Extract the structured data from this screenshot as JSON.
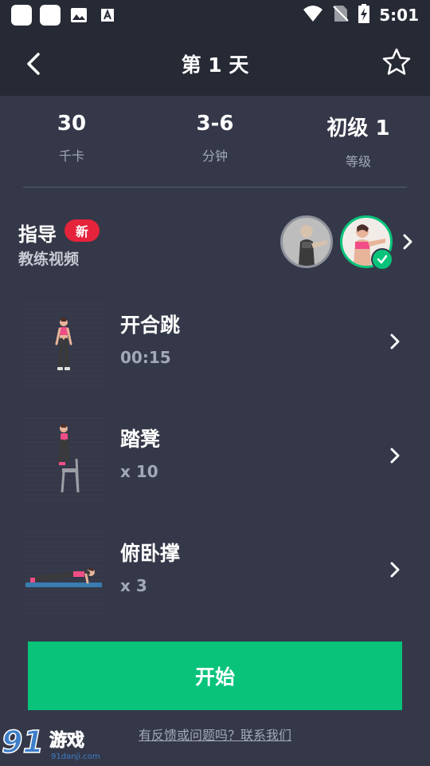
{
  "status_bar": {
    "time": "5:01",
    "icons": [
      "app-icon",
      "app-icon",
      "image-icon",
      "font-icon",
      "wifi-icon",
      "no-sim-icon",
      "battery-charging-icon"
    ]
  },
  "header": {
    "title": "第 1 天",
    "back_icon": "chevron-left-icon",
    "favorite_icon": "star-outline-icon"
  },
  "stats": [
    {
      "value": "30",
      "label": "千卡"
    },
    {
      "value": "3-6",
      "label": "分钟"
    },
    {
      "value": "初级 1",
      "label": "等级"
    }
  ],
  "guide": {
    "title": "指导",
    "badge": "新",
    "subtitle": "教练视频"
  },
  "exercises": [
    {
      "name": "开合跳",
      "detail": "00:15"
    },
    {
      "name": "踏凳",
      "detail": "x 10"
    },
    {
      "name": "俯卧撑",
      "detail": "x 3"
    }
  ],
  "start_button": "开始",
  "feedback_link": "有反馈或问题吗？联系我们",
  "watermark": {
    "brand": "游戏",
    "number": "91",
    "site": "91danji.com"
  },
  "colors": {
    "background": "#343848",
    "header": "#262a35",
    "accent": "#09c37b",
    "badge": "#e5243b",
    "muted_text": "#a3a8b6"
  }
}
